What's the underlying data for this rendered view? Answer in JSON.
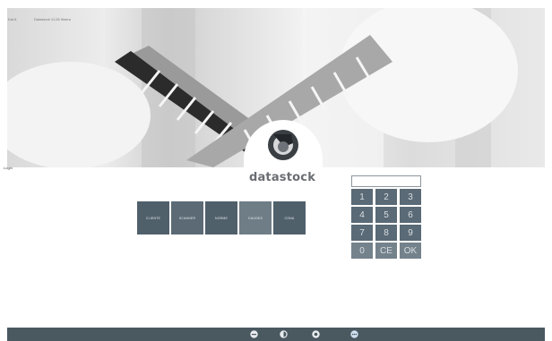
{
  "hero": {
    "caption_left": "Kat 6",
    "caption_mid": "Datastock 11:28 Itinera"
  },
  "brand": {
    "name": "datastock"
  },
  "left_label": "Login",
  "actions": [
    {
      "label": "Cliente"
    },
    {
      "label": "Scanner"
    },
    {
      "label": "Norme"
    },
    {
      "label": "Gauges"
    },
    {
      "label": "Cona"
    }
  ],
  "keypad": {
    "display_value": "",
    "keys": [
      "1",
      "2",
      "3",
      "4",
      "5",
      "6",
      "7",
      "8",
      "9",
      "0",
      "CE",
      "OK"
    ]
  },
  "taskbar": {
    "icons": [
      "minus-circle-icon",
      "info-icon",
      "settings-icon",
      "more-icon"
    ]
  },
  "colors": {
    "accent": "#50606b",
    "taskbar": "#4a5860",
    "brand_text": "#6a6e73"
  }
}
